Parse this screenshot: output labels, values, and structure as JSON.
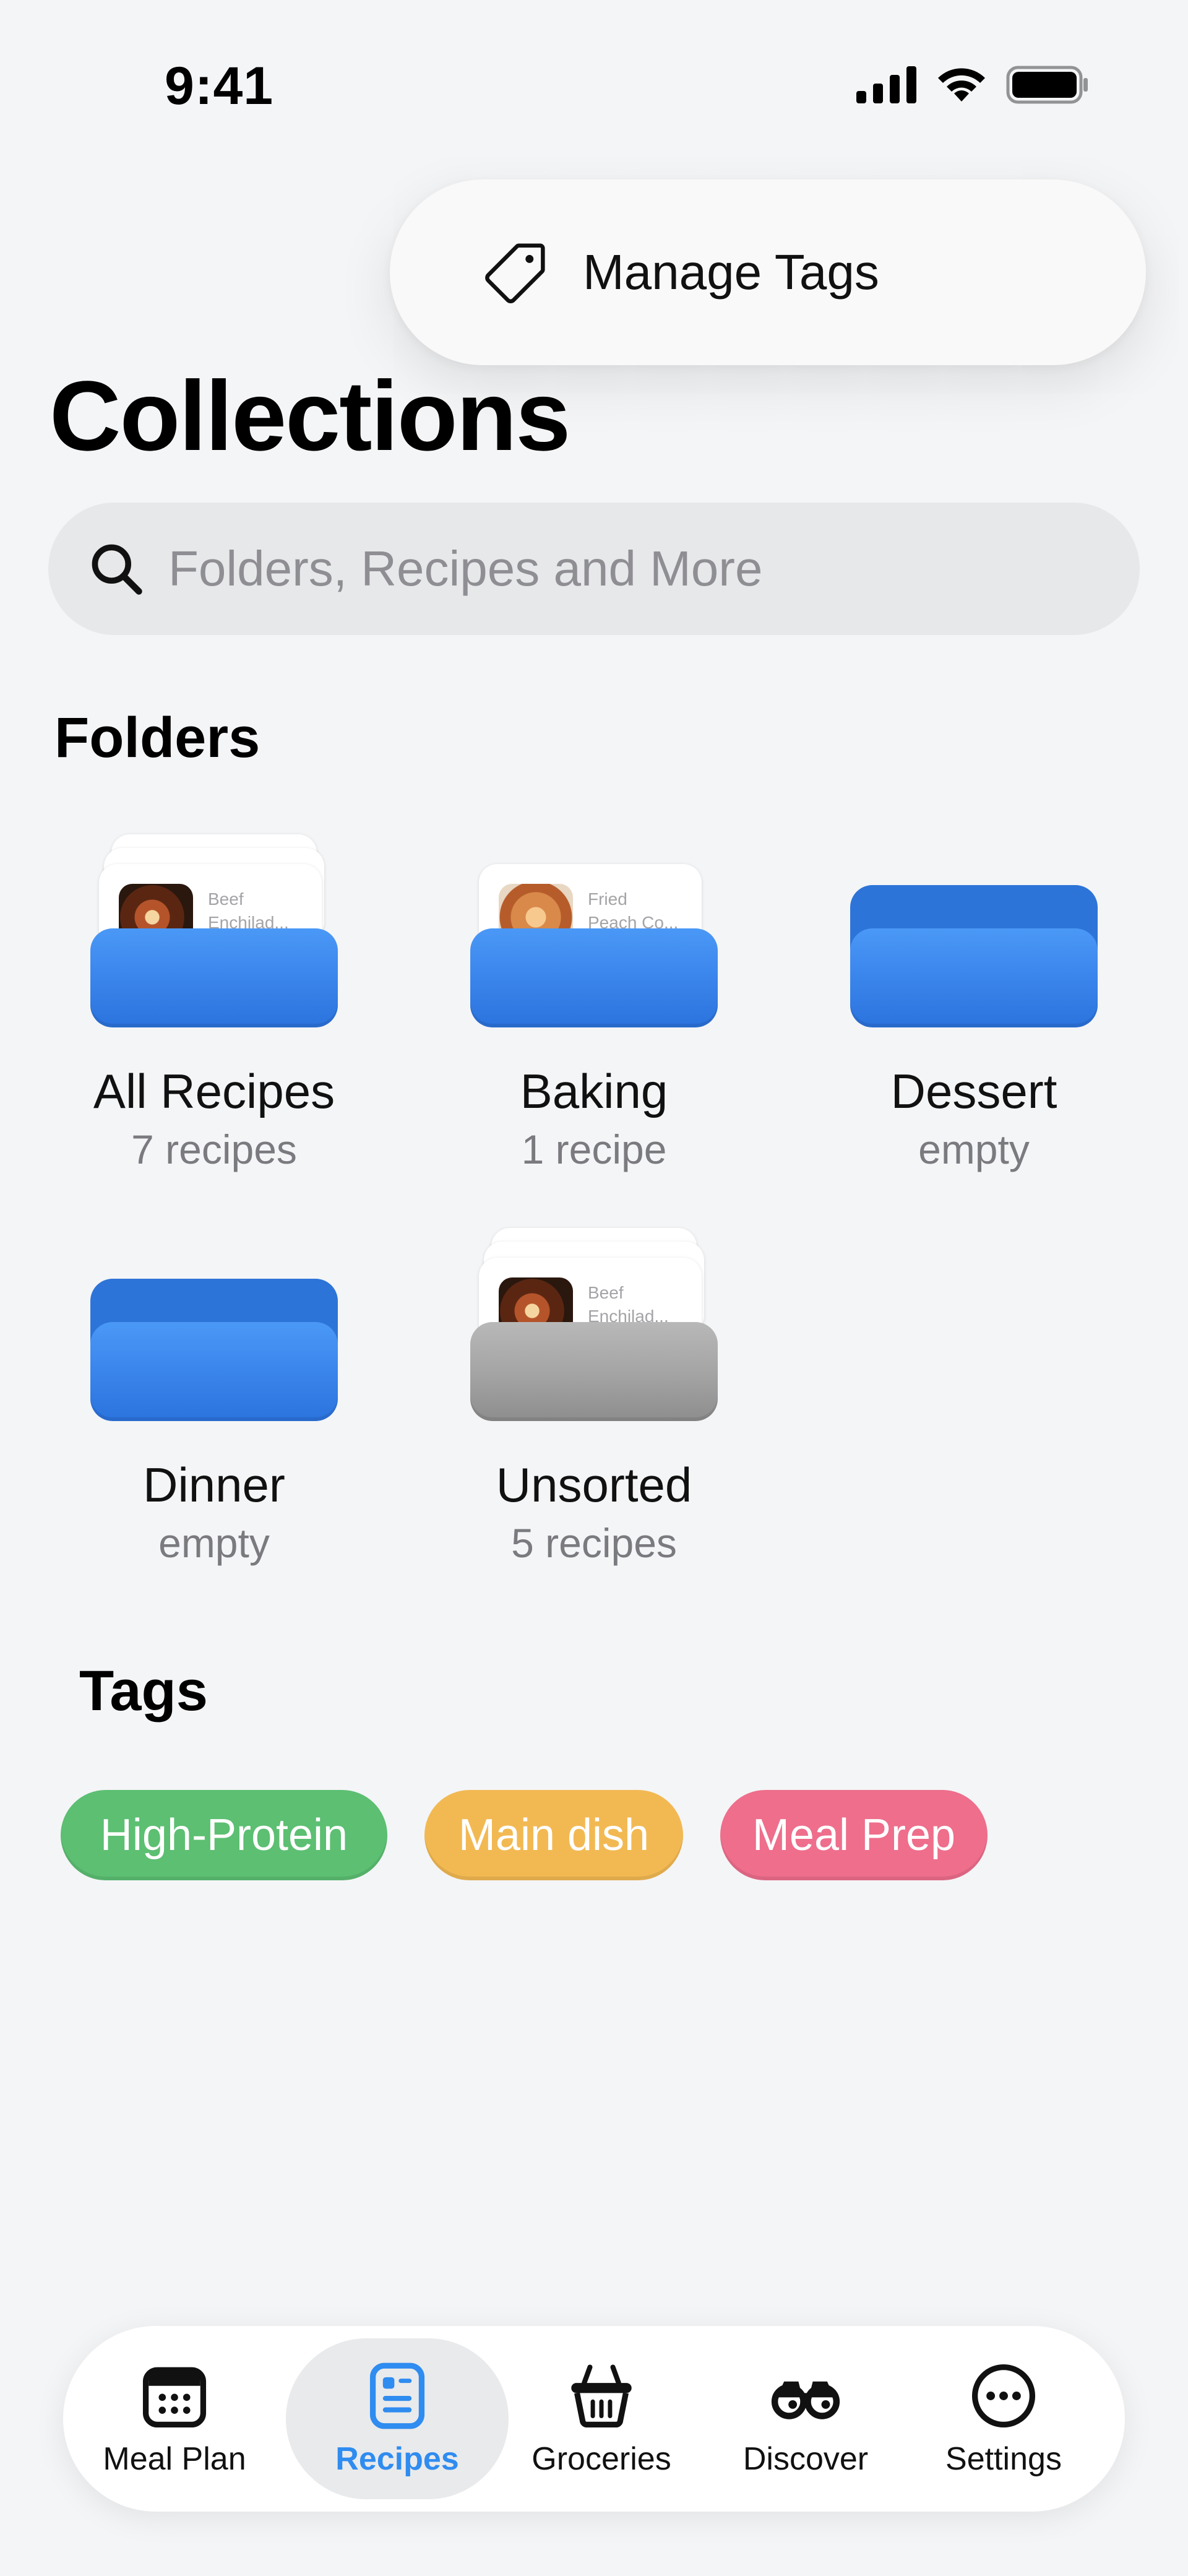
{
  "status": {
    "time": "9:41"
  },
  "menu": {
    "manage_tags_label": "Manage Tags"
  },
  "page_title": "Collections",
  "search": {
    "placeholder": "Folders, Recipes and More"
  },
  "folders_section_title": "Folders",
  "folders": [
    {
      "name": "All Recipes",
      "count": "7 recipes",
      "card_text": "Beef\nEnchilad..."
    },
    {
      "name": "Baking",
      "count": "1 recipe",
      "card_text": "Fried\nPeach Co..."
    },
    {
      "name": "Dessert",
      "count": "empty"
    },
    {
      "name": "Dinner",
      "count": "empty"
    },
    {
      "name": "Unsorted",
      "count": "5 recipes",
      "card_text": "Beef\nEnchilad..."
    }
  ],
  "tags_section_title": "Tags",
  "tags": [
    {
      "label": "High-Protein",
      "color": "#5cbf72"
    },
    {
      "label": "Main dish",
      "color": "#f2b953"
    },
    {
      "label": "Meal Prep",
      "color": "#ee6e8c"
    }
  ],
  "tabbar": {
    "items": [
      {
        "label": "Meal Plan",
        "icon": "calendar-icon"
      },
      {
        "label": "Recipes",
        "icon": "recipe-card-icon",
        "active": true
      },
      {
        "label": "Groceries",
        "icon": "basket-icon"
      },
      {
        "label": "Discover",
        "icon": "binoculars-icon"
      },
      {
        "label": "Settings",
        "icon": "more-dots-icon"
      }
    ],
    "accent_color": "#2f8cf0"
  }
}
